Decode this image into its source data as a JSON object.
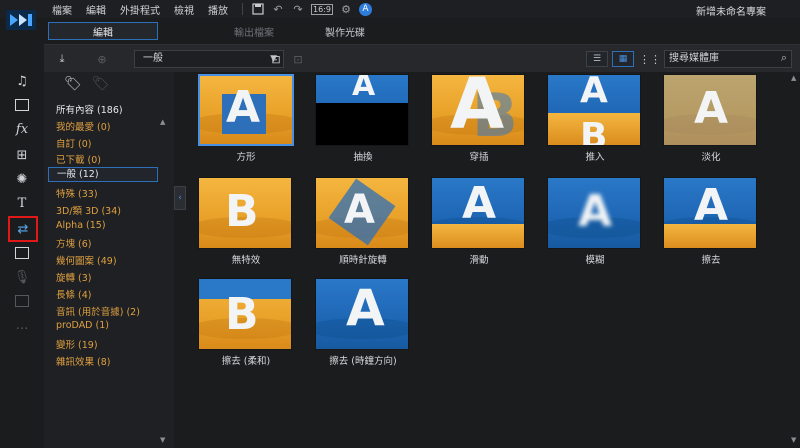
{
  "menu": {
    "items": [
      "檔案",
      "編輯",
      "外掛程式",
      "檢視",
      "播放"
    ],
    "ratio_label": "16:9",
    "help_label": "A",
    "project_title": "新增未命名專案"
  },
  "mode_tabs": [
    {
      "label": "編輯",
      "active": true
    },
    {
      "label": "輸出檔案",
      "active": false
    },
    {
      "label": "製作光碟",
      "active": false
    }
  ],
  "toolbar": {
    "category_select": "一般",
    "search_placeholder": "搜尋媒體庫"
  },
  "categories": [
    {
      "label": "所有內容 (186)",
      "style": "white"
    },
    {
      "label": "我的最愛 (0)",
      "style": "orange"
    },
    {
      "label": "自訂 (0)",
      "style": "orange"
    },
    {
      "label": "已下載 (0)",
      "style": "orange"
    },
    {
      "label": "一般 (12)",
      "style": "active"
    },
    {
      "label": "特殊 (33)",
      "style": "orange"
    },
    {
      "label": "3D/類 3D (34)",
      "style": "orange"
    },
    {
      "label": "Alpha (15)",
      "style": "orange"
    },
    {
      "label": "方塊 (6)",
      "style": "orange"
    },
    {
      "label": "幾何圖案 (49)",
      "style": "orange"
    },
    {
      "label": "旋轉 (3)",
      "style": "orange"
    },
    {
      "label": "長條 (4)",
      "style": "orange"
    },
    {
      "label": "音訊 (用於音據) (2)",
      "style": "orange"
    },
    {
      "label": "proDAD (1)",
      "style": "orange"
    },
    {
      "label": "變形 (19)",
      "style": "orange"
    },
    {
      "label": "雜訊效果 (8)",
      "style": "orange"
    }
  ],
  "transitions": [
    {
      "label": "方形"
    },
    {
      "label": "抽換"
    },
    {
      "label": "穿插"
    },
    {
      "label": "推入"
    },
    {
      "label": "淡化"
    },
    {
      "label": "無特效"
    },
    {
      "label": "順時針旋轉"
    },
    {
      "label": "滑動"
    },
    {
      "label": "模糊"
    },
    {
      "label": "擦去"
    },
    {
      "label": "擦去 (柔和)"
    },
    {
      "label": "擦去 (時鐘方向)"
    }
  ],
  "thumb_letters": {
    "a": "A",
    "b": "B"
  },
  "colors": {
    "accent": "#2d6fb8",
    "category_text": "#e0a040",
    "selection_red": "#e01818",
    "thumb_orange": "#f4b640",
    "thumb_blue": "#1d66b4"
  }
}
